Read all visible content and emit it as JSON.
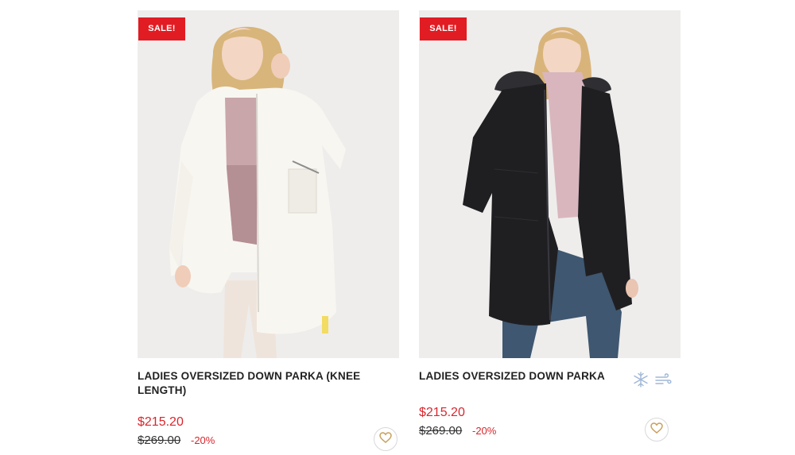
{
  "products": [
    {
      "badge": "SALE!",
      "title": "LADIES OVERSIZED DOWN PARKA (KNEE LENGTH)",
      "price": "$215.20",
      "old_price": "$269.00",
      "discount": "-20%",
      "image_desc": "woman-in-white-parka"
    },
    {
      "badge": "SALE!",
      "title": "LADIES OVERSIZED DOWN PARKA",
      "price": "$215.20",
      "old_price": "$269.00",
      "discount": "-20%",
      "features": [
        "snowflake-icon",
        "wind-icon"
      ],
      "image_desc": "woman-in-black-parka"
    }
  ],
  "colors": {
    "sale_badge": "#e21c23",
    "price": "#d9262c",
    "heart": "#c9a05a",
    "feature_icon": "#9fb7d8"
  }
}
